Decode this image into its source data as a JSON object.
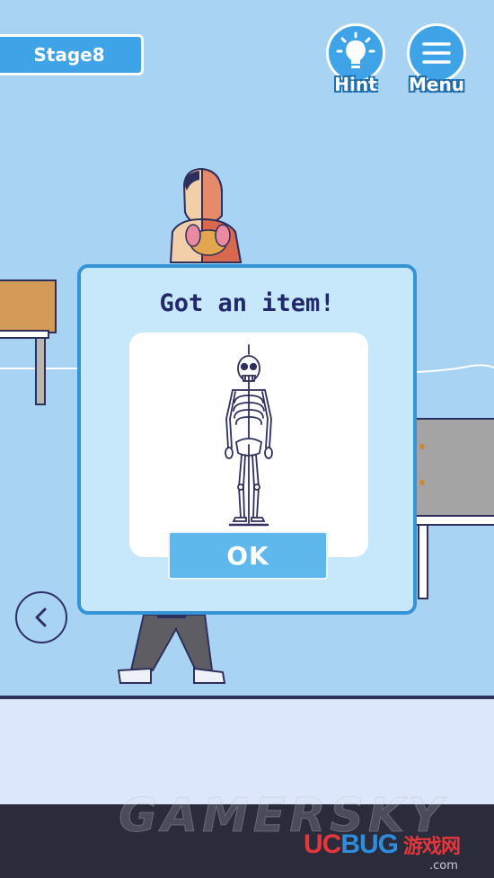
{
  "hud": {
    "stage_label": "Stage8",
    "hint_label": "Hint",
    "menu_label": "Menu",
    "hint_icon": "lightbulb-icon",
    "menu_icon": "hamburger-menu-icon",
    "back_icon": "chevron-left-icon"
  },
  "dialog": {
    "title": "Got an item!",
    "item_name": "skeleton",
    "ok_label": "OK"
  },
  "watermark": {
    "text": "GAMERSKY",
    "brand_uc": "UC",
    "brand_bug": "BUG",
    "brand_cn": "游戏网",
    "brand_domain": ".com"
  },
  "colors": {
    "wall": "#a9d3f3",
    "accent_blue": "#3ea4e7",
    "dialog_bg": "#c7e7fb",
    "dialog_border": "#3594d6",
    "title_text": "#23286d",
    "ok_button": "#5fb8ec",
    "floor": "#dde7fb",
    "bottom_bar": "#2a2b3b"
  }
}
